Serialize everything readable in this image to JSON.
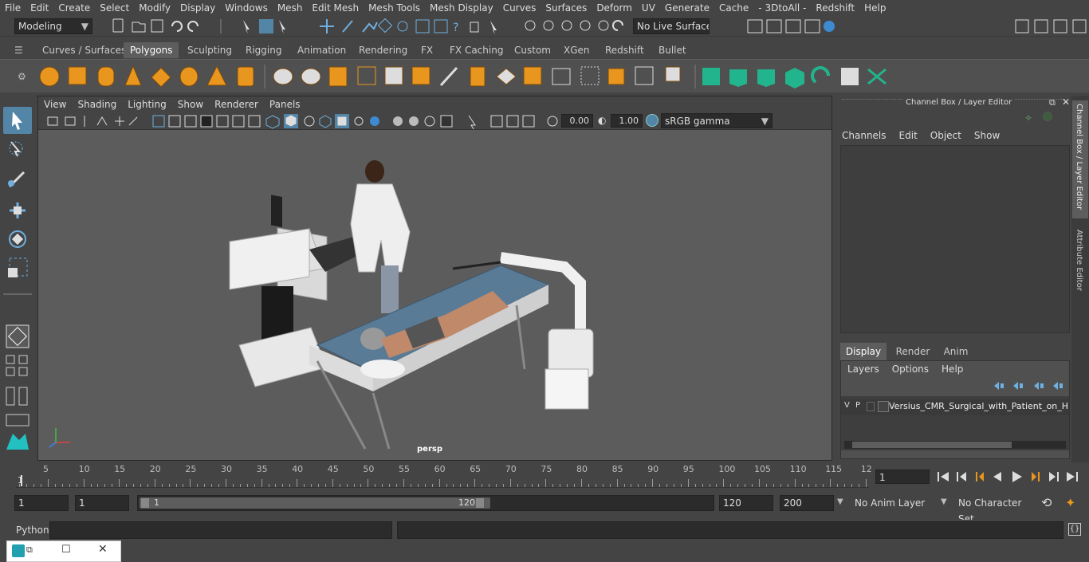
{
  "menubar": [
    "File",
    "Edit",
    "Create",
    "Select",
    "Modify",
    "Display",
    "Windows",
    "Mesh",
    "Edit Mesh",
    "Mesh Tools",
    "Mesh Display",
    "Curves",
    "Surfaces",
    "Deform",
    "UV",
    "Generate",
    "Cache",
    "- 3DtoAll -",
    "Redshift",
    "Help"
  ],
  "status": {
    "mode": "Modeling",
    "live_surface": "No Live Surface"
  },
  "shelf_tabs": [
    "Curves / Surfaces",
    "Polygons",
    "Sculpting",
    "Rigging",
    "Animation",
    "Rendering",
    "FX",
    "FX Caching",
    "Custom",
    "XGen",
    "Redshift",
    "Bullet"
  ],
  "shelf_active": "Polygons",
  "viewport": {
    "menu": [
      "View",
      "Shading",
      "Lighting",
      "Show",
      "Renderer",
      "Panels"
    ],
    "near_value": "0.00",
    "far_value": "1.00",
    "color_space": "sRGB gamma",
    "camera_label": "persp"
  },
  "channel_box": {
    "title": "Channel Box / Layer Editor",
    "menu": [
      "Channels",
      "Edit",
      "Object",
      "Show"
    ],
    "layer_tabs": [
      "Display",
      "Render",
      "Anim"
    ],
    "layer_tab_active": "Display",
    "layer_menu": [
      "Layers",
      "Options",
      "Help"
    ],
    "layer_row": {
      "v": "V",
      "p": "P",
      "name": "Versius_CMR_Surgical_with_Patient_on_Hos"
    }
  },
  "side_tabs": [
    "Channel Box / Layer Editor",
    "Attribute Editor"
  ],
  "timeline": {
    "ticks": [
      "5",
      "10",
      "15",
      "20",
      "25",
      "30",
      "35",
      "40",
      "45",
      "50",
      "55",
      "60",
      "65",
      "70",
      "75",
      "80",
      "85",
      "90",
      "95",
      "100",
      "105",
      "110",
      "115",
      "12"
    ],
    "start_marker": "1",
    "current_frame": "1"
  },
  "range": {
    "start": "1",
    "playback_start": "1",
    "slider_start": "1",
    "slider_end": "120",
    "playback_end": "120",
    "end": "200",
    "anim_layer": "No Anim Layer",
    "character_set": "No Character Set"
  },
  "cmdline": {
    "label": "Python"
  },
  "colors": {
    "accent": "#5285a6",
    "viewport_bg": "#5c5c5c",
    "panel": "#444444"
  }
}
